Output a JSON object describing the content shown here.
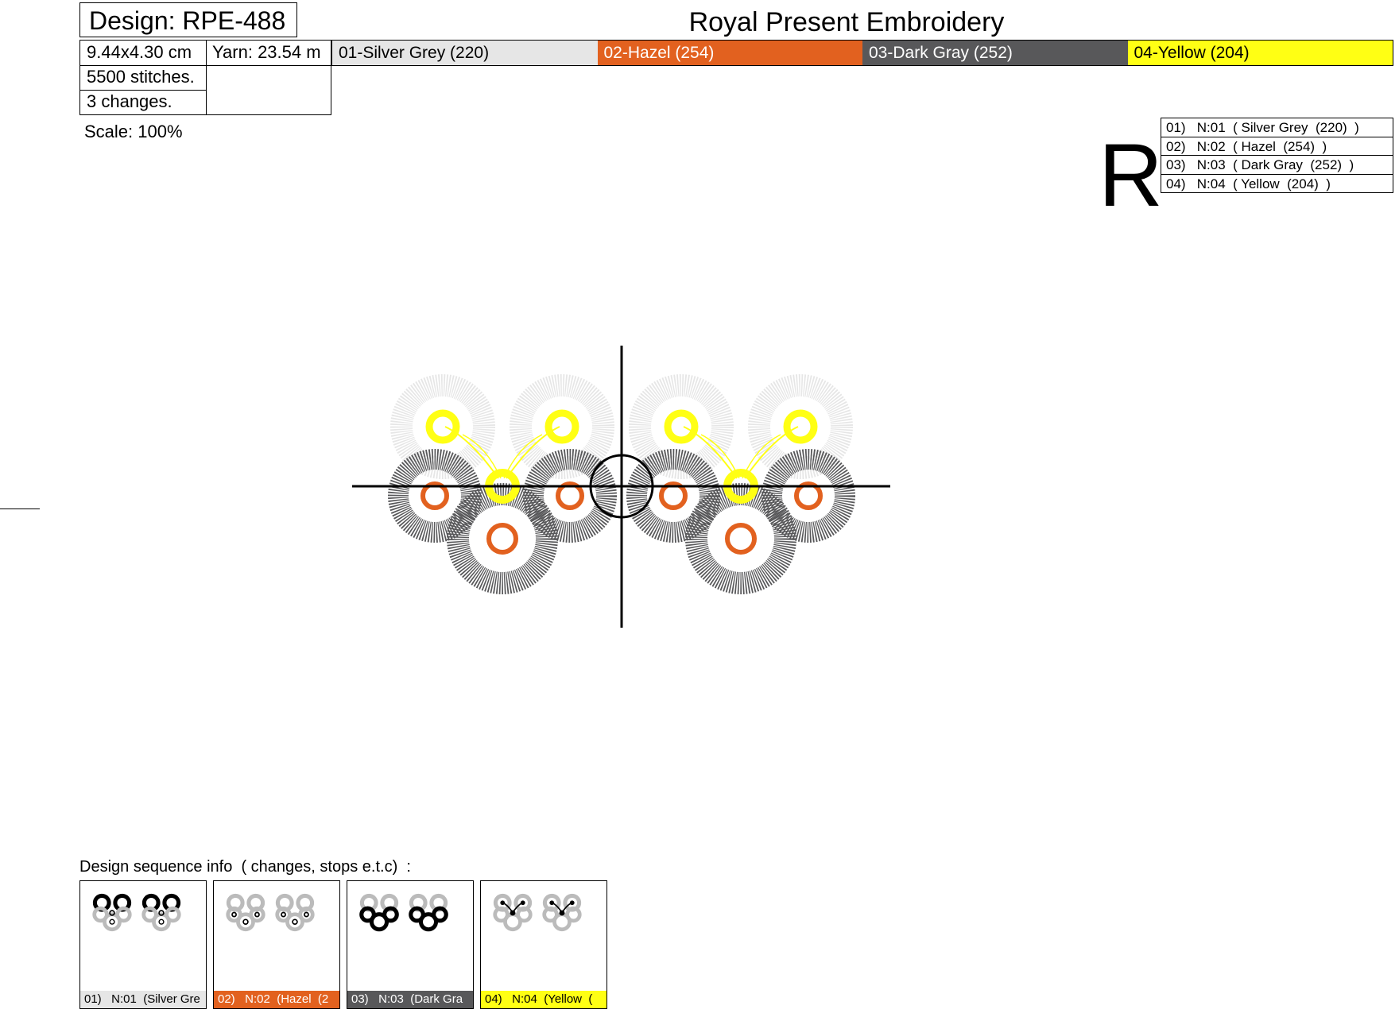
{
  "header": {
    "design_title": "Design: RPE-488",
    "brand": "Royal Present Embroidery"
  },
  "info": {
    "size": "9.44x4.30 cm",
    "yarn": "Yarn: 23.54 m",
    "stitches": "5500 stitches.",
    "changes": "3 changes.",
    "scale": "Scale: 100%"
  },
  "colors": [
    {
      "label": "01-Silver Grey  (220)",
      "bg": "#e6e6e6",
      "fg": "#000000"
    },
    {
      "label": "02-Hazel  (254)",
      "bg": "#e2611f",
      "fg": "#ffffff"
    },
    {
      "label": "03-Dark Gray  (252)",
      "bg": "#58585a",
      "fg": "#ffffff"
    },
    {
      "label": "04-Yellow  (204)",
      "bg": "#ffff14",
      "fg": "#000000"
    }
  ],
  "legend_letter": "R",
  "legend": [
    "01)   N:01  ( Silver Grey  (220)  )",
    "02)   N:02  ( Hazel  (254)  )",
    "03)   N:03  ( Dark Gray  (252)  )",
    "04)   N:04  ( Yellow  (204)  )"
  ],
  "sequence": {
    "title": "Design sequence info  ( changes, stops e.t.c)  :",
    "steps": [
      {
        "caption": "01)   N:01  (Silver Gre",
        "bg": "#e6e6e6",
        "fg": "#000000"
      },
      {
        "caption": "02)   N:02  (Hazel  (2",
        "bg": "#e2611f",
        "fg": "#ffffff"
      },
      {
        "caption": "03)   N:03  (Dark Gra",
        "bg": "#58585a",
        "fg": "#ffffff"
      },
      {
        "caption": "04)   N:04  (Yellow  (",
        "bg": "#ffff14",
        "fg": "#000000"
      }
    ]
  }
}
